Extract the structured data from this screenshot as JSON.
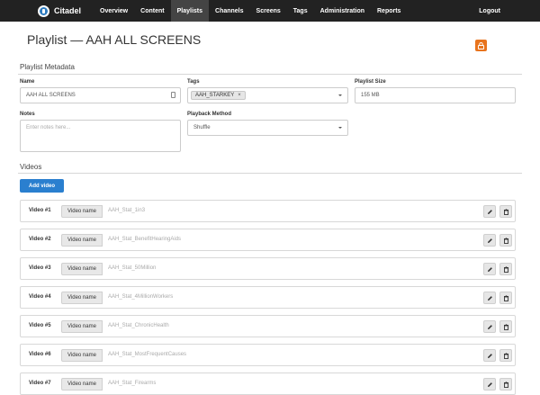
{
  "nav": {
    "brand": "Citadel",
    "items": [
      {
        "label": "Overview",
        "active": false
      },
      {
        "label": "Content",
        "active": false
      },
      {
        "label": "Playlists",
        "active": true
      },
      {
        "label": "Channels",
        "active": false
      },
      {
        "label": "Screens",
        "active": false
      },
      {
        "label": "Tags",
        "active": false
      },
      {
        "label": "Administration",
        "active": false
      },
      {
        "label": "Reports",
        "active": false
      }
    ],
    "logout": "Logout"
  },
  "page": {
    "title": "Playlist — AAH ALL SCREENS"
  },
  "metadata": {
    "section_title": "Playlist Metadata",
    "name_label": "Name",
    "name_value": "AAH ALL SCREENS",
    "tags_label": "Tags",
    "tag_chip": "AAH_STARKEY",
    "tag_remove": "×",
    "size_label": "Playlist Size",
    "size_value": "155 MB",
    "notes_label": "Notes",
    "notes_placeholder": "Enter notes here...",
    "playback_label": "Playback Method",
    "playback_value": "Shuffle"
  },
  "videos": {
    "section_title": "Videos",
    "add_label": "Add video",
    "name_label": "Video name",
    "items": [
      {
        "num": "Video #1",
        "value": "AAH_Stat_1in3"
      },
      {
        "num": "Video #2",
        "value": "AAH_Stat_BenefitHearingAids"
      },
      {
        "num": "Video #3",
        "value": "AAH_Stat_50Million"
      },
      {
        "num": "Video #4",
        "value": "AAH_Stat_4MillionWorkers"
      },
      {
        "num": "Video #5",
        "value": "AAH_Stat_ChronicHealth"
      },
      {
        "num": "Video #6",
        "value": "AAH_Stat_MostFrequentCauses"
      },
      {
        "num": "Video #7",
        "value": "AAH_Stat_Firearms"
      }
    ]
  },
  "colors": {
    "navbar": "#222222",
    "nav_active": "#444444",
    "primary": "#2a7fcf",
    "lock_button": "#e8741e"
  }
}
